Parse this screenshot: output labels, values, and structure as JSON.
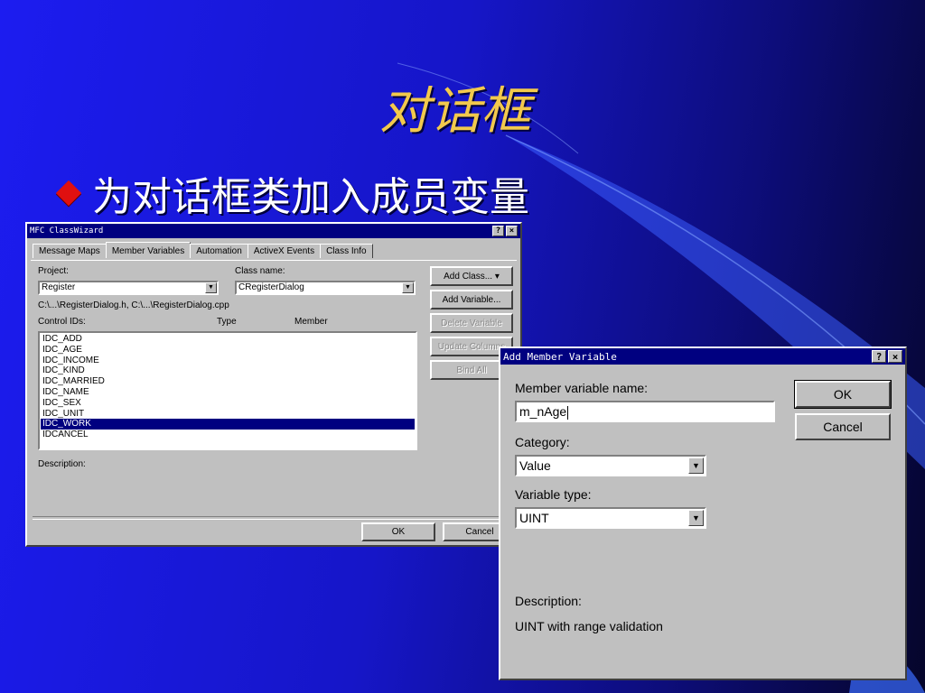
{
  "slide": {
    "title": "对话框",
    "bullet": "为对话框类加入成员变量"
  },
  "colors": {
    "title": "#f2c94c",
    "bullet_marker": "#e01010",
    "win_title": "#000080"
  },
  "classwizard": {
    "title": "MFC ClassWizard",
    "help": "?",
    "close": "×",
    "tabs": [
      "Message Maps",
      "Member Variables",
      "Automation",
      "ActiveX Events",
      "Class Info"
    ],
    "active_tab": "Member Variables",
    "project_label": "Project:",
    "project_value": "Register",
    "class_label": "Class name:",
    "class_value": "CRegisterDialog",
    "files": "C:\\...\\RegisterDialog.h, C:\\...\\RegisterDialog.cpp",
    "control_ids_label": "Control IDs:",
    "type_header": "Type",
    "member_header": "Member",
    "control_ids": [
      "IDC_ADD",
      "IDC_AGE",
      "IDC_INCOME",
      "IDC_KIND",
      "IDC_MARRIED",
      "IDC_NAME",
      "IDC_SEX",
      "IDC_UNIT",
      "IDC_WORK",
      "IDCANCEL"
    ],
    "selected_id": "IDC_WORK",
    "buttons": {
      "add_class": "Add Class...",
      "add_variable": "Add Variable...",
      "delete_variable": "Delete Variable",
      "update_columns": "Update Columns",
      "bind_all": "Bind All"
    },
    "description_label": "Description:",
    "ok": "OK",
    "cancel": "Cancel"
  },
  "add_member": {
    "title": "Add Member Variable",
    "help": "?",
    "close": "×",
    "name_label": "Member variable name:",
    "name_value": "m_nAge",
    "category_label": "Category:",
    "category_value": "Value",
    "type_label": "Variable type:",
    "type_value": "UINT",
    "description_label": "Description:",
    "description_value": "UINT with range validation",
    "ok": "OK",
    "cancel": "Cancel"
  }
}
